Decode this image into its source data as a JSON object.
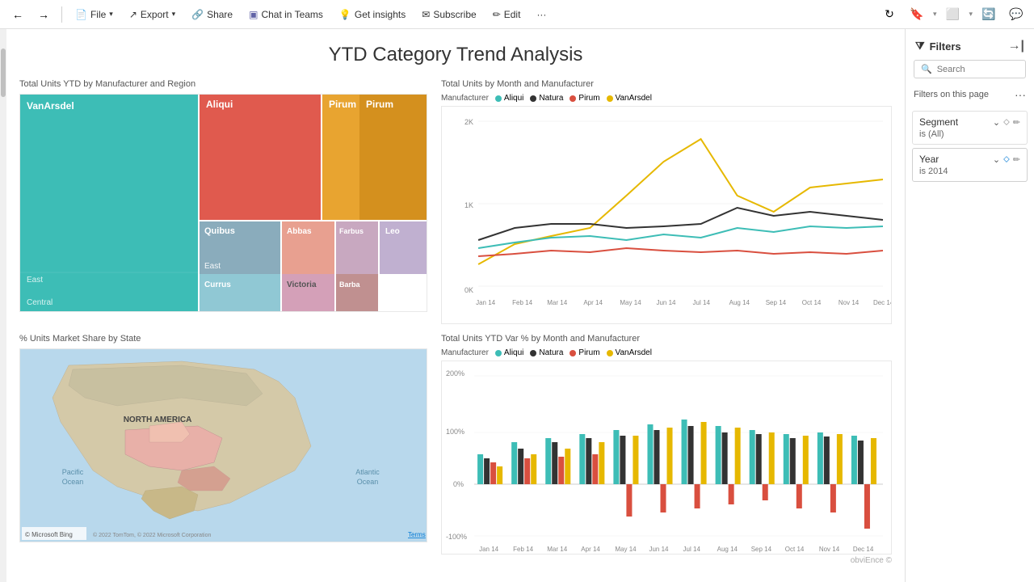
{
  "toolbar": {
    "nav_back": "⟵",
    "nav_fwd": "⟶",
    "file_label": "File",
    "export_label": "Export",
    "share_label": "Share",
    "chat_in_teams": "Chat in Teams",
    "get_insights": "Get insights",
    "subscribe_label": "Subscribe",
    "edit_label": "Edit",
    "more_label": "···"
  },
  "page": {
    "title": "YTD Category Trend Analysis"
  },
  "charts": {
    "treemap_title": "Total Units YTD by Manufacturer and Region",
    "linechart_title": "Total Units by Month and Manufacturer",
    "map_title": "% Units Market Share by State",
    "barchart_title": "Total Units YTD Var % by Month and Manufacturer"
  },
  "legend": {
    "aliqui_label": "Aliqui",
    "natura_label": "Natura",
    "pirum_label": "Pirum",
    "vanarsdel_label": "VanArsdel",
    "aliqui_color": "#3dbdb6",
    "natura_color": "#333333",
    "pirum_color": "#d94f3f",
    "vanarsdel_color": "#e6b800"
  },
  "filters": {
    "panel_title": "Filters",
    "search_placeholder": "Search",
    "filters_on_page_label": "Filters on this page",
    "more_options": "···",
    "segment_filter": {
      "label": "Segment",
      "value": "is (All)"
    },
    "year_filter": {
      "label": "Year",
      "value": "is 2014"
    }
  },
  "map": {
    "north_america_label": "NORTH AMERICA",
    "pacific_ocean_label": "Pacific\nOcean",
    "atlantic_ocean_label": "Atlantic\nOcean",
    "bing_credit": "© Microsoft Bing",
    "tomtom_credit": "© 2022 TomTom, © 2022 Microsoft Corporation",
    "legal": "Terms"
  },
  "x_axis_months": [
    "Jan 14",
    "Feb 14",
    "Mar 14",
    "Apr 14",
    "May 14",
    "Jun 14",
    "Jul 14",
    "Aug 14",
    "Sep 14",
    "Oct 14",
    "Nov 14",
    "Dec 14"
  ],
  "obvience": "obviEnce ©"
}
